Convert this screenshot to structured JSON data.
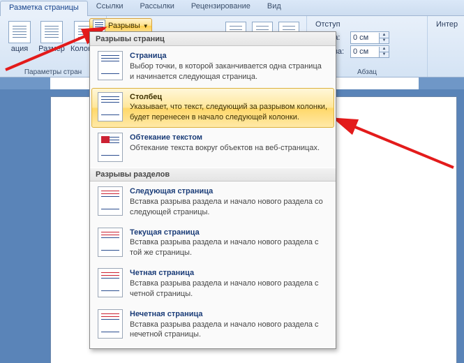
{
  "tabs": {
    "pageLayout": "Разметка страницы",
    "references": "Ссылки",
    "mailings": "Рассылки",
    "review": "Рецензирование",
    "view": "Вид"
  },
  "ribbon": {
    "orientation": "ация",
    "size": "Размер",
    "columns": "Колонки",
    "breaksLabel": "Разрывы",
    "pageParamsGroup": "Параметры стран",
    "indentLabel": "Отступ",
    "indentLeftLabel": "Слева:",
    "indentRightLabel": "Справа:",
    "indentLeftValue": "0 см",
    "indentRightValue": "0 см",
    "intervalLabel": "Интер",
    "paragraphGroup": "Абзац"
  },
  "menu": {
    "pageBreaksHeader": "Разрывы страниц",
    "sectionBreaksHeader": "Разрывы разделов",
    "items": [
      {
        "title": "Страница",
        "desc": "Выбор точки, в которой заканчивается одна страница и начинается следующая страница."
      },
      {
        "title": "Столбец",
        "desc": "Указывает, что текст, следующий за разрывом колонки, будет перенесен в начало следующей колонки."
      },
      {
        "title": "Обтекание текстом",
        "desc": "Обтекание текста вокруг объектов на веб-страницах."
      },
      {
        "title": "Следующая страница",
        "desc": "Вставка разрыва раздела и начало нового раздела со следующей страницы."
      },
      {
        "title": "Текущая страница",
        "desc": "Вставка разрыва раздела и начало нового раздела с той же страницы."
      },
      {
        "title": "Четная страница",
        "desc": "Вставка разрыва раздела и начало нового раздела с четной страницы."
      },
      {
        "title": "Нечетная страница",
        "desc": "Вставка разрыва раздела и начало нового раздела с нечетной страницы."
      }
    ]
  }
}
